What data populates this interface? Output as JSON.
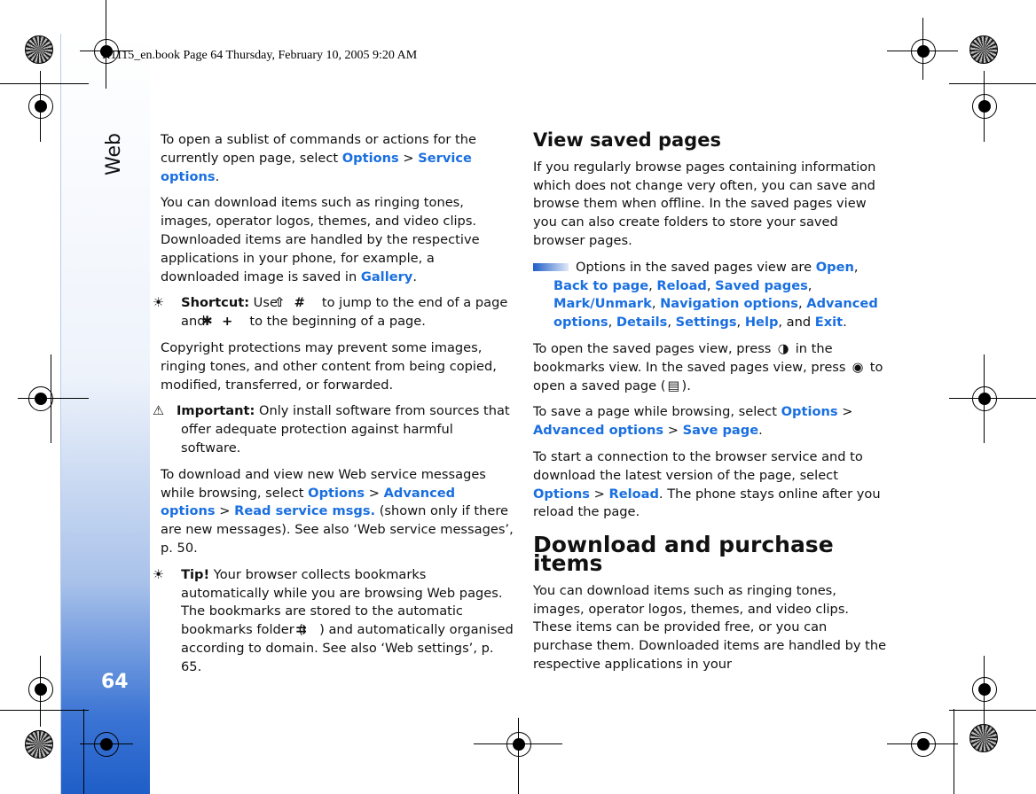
{
  "header": {
    "print_line": "R1115_en.book  Page 64  Thursday, February 10, 2005  9:20 AM"
  },
  "sidebar": {
    "section": "Web",
    "page_number": "64",
    "accent": "#1f5ec8"
  },
  "colors": {
    "link": "#1a6fe0"
  },
  "left_column": [
    {
      "type": "p",
      "runs": [
        {
          "t": "To open a sublist of commands or actions for the currently open page, select "
        },
        {
          "t": "Options",
          "s": "link"
        },
        {
          "t": " > "
        },
        {
          "t": "Service options",
          "s": "link"
        },
        {
          "t": "."
        }
      ]
    },
    {
      "type": "p",
      "runs": [
        {
          "t": "You can download items such as ringing tones, images, operator logos, themes, and video clips. Downloaded items are handled by the respective applications in your phone, for example, a downloaded image is saved in "
        },
        {
          "t": "Gallery",
          "s": "link"
        },
        {
          "t": "."
        }
      ]
    },
    {
      "type": "ind",
      "runs": [
        {
          "t": "☀",
          "s": "icon",
          "icon": "tip-bulb-icon"
        },
        {
          "t": " Shortcut:",
          "s": "bold"
        },
        {
          "t": " Use "
        },
        {
          "t": "⇧",
          "s": "icon",
          "icon": "shift-key-icon"
        },
        {
          "t": " "
        },
        {
          "t": "#",
          "s": "icon",
          "icon": "hash-key-icon"
        },
        {
          "t": " to jump to the end of a page and "
        },
        {
          "t": "✱",
          "s": "icon",
          "icon": "star-key-icon"
        },
        {
          "t": " "
        },
        {
          "t": "+",
          "s": "icon",
          "icon": "plus-key-icon"
        },
        {
          "t": " to the beginning of a page."
        }
      ]
    },
    {
      "type": "p",
      "runs": [
        {
          "t": "Copyright protections may prevent some images, ringing tones, and other content from being copied, modified, transferred, or forwarded."
        }
      ]
    },
    {
      "type": "ind",
      "runs": [
        {
          "t": "⚠",
          "s": "icon",
          "icon": "warning-icon"
        },
        {
          "t": "Important:",
          "s": "bold"
        },
        {
          "t": " Only install software from sources that offer adequate protection against harmful software."
        }
      ]
    },
    {
      "type": "p",
      "runs": [
        {
          "t": "To download and view new Web service messages while browsing, select "
        },
        {
          "t": "Options",
          "s": "link"
        },
        {
          "t": " > "
        },
        {
          "t": "Advanced options",
          "s": "link"
        },
        {
          "t": " > "
        },
        {
          "t": "Read service msgs.",
          "s": "link"
        },
        {
          "t": " (shown only if there are new messages). See also ‘Web service messages’, p. 50."
        }
      ]
    },
    {
      "type": "ind",
      "runs": [
        {
          "t": "☀",
          "s": "icon",
          "icon": "tip-bulb-icon"
        },
        {
          "t": " Tip!",
          "s": "bold"
        },
        {
          "t": " Your browser collects bookmarks automatically while you are browsing Web pages. The bookmarks are stored to the automatic bookmarks folder ("
        },
        {
          "t": "⇉",
          "s": "icon",
          "icon": "auto-bookmarks-folder-icon"
        },
        {
          "t": ") and automatically organised according to domain. See also ‘Web settings’, p. 65."
        }
      ]
    }
  ],
  "right_column": [
    {
      "type": "h2",
      "runs": [
        {
          "t": "View saved pages"
        }
      ]
    },
    {
      "type": "p",
      "runs": [
        {
          "t": "If you regularly browse pages containing information which does not change very often, you can save and browse them when offline. In the saved pages view you can also create folders to store your saved browser pages."
        }
      ]
    },
    {
      "type": "note",
      "runs": [
        {
          "t": "Options in the saved pages view are "
        },
        {
          "t": "Open",
          "s": "link"
        },
        {
          "t": ", "
        },
        {
          "t": "Back to page",
          "s": "link"
        },
        {
          "t": ", "
        },
        {
          "t": "Reload",
          "s": "link"
        },
        {
          "t": ", "
        },
        {
          "t": "Saved pages",
          "s": "link"
        },
        {
          "t": ", "
        },
        {
          "t": "Mark/Unmark",
          "s": "link"
        },
        {
          "t": ", "
        },
        {
          "t": "Navigation options",
          "s": "link"
        },
        {
          "t": ", "
        },
        {
          "t": "Advanced options",
          "s": "link"
        },
        {
          "t": ", "
        },
        {
          "t": "Details",
          "s": "link"
        },
        {
          "t": ", "
        },
        {
          "t": "Settings",
          "s": "link"
        },
        {
          "t": ", "
        },
        {
          "t": "Help",
          "s": "link"
        },
        {
          "t": ", and "
        },
        {
          "t": "Exit",
          "s": "link"
        },
        {
          "t": "."
        }
      ]
    },
    {
      "type": "p",
      "runs": [
        {
          "t": "To open the saved pages view, press "
        },
        {
          "t": "◑",
          "s": "icon",
          "icon": "joystick-right-icon"
        },
        {
          "t": " in the bookmarks view. In the saved pages view, press "
        },
        {
          "t": "◉",
          "s": "icon",
          "icon": "joystick-press-icon"
        },
        {
          "t": " to open a saved page ("
        },
        {
          "t": "▤",
          "s": "icon",
          "icon": "saved-page-icon"
        },
        {
          "t": ")."
        }
      ]
    },
    {
      "type": "p",
      "runs": [
        {
          "t": "To save a page while browsing, select "
        },
        {
          "t": "Options",
          "s": "link"
        },
        {
          "t": " > "
        },
        {
          "t": "Advanced options",
          "s": "link"
        },
        {
          "t": " > "
        },
        {
          "t": "Save page",
          "s": "link"
        },
        {
          "t": "."
        }
      ]
    },
    {
      "type": "p",
      "runs": [
        {
          "t": "To start a connection to the browser service and to download the latest version of the page, select "
        },
        {
          "t": "Options",
          "s": "link"
        },
        {
          "t": " > "
        },
        {
          "t": "Reload",
          "s": "link"
        },
        {
          "t": ". The phone stays online after you reload the page."
        }
      ]
    },
    {
      "type": "h1",
      "runs": [
        {
          "t": "Download and purchase items"
        }
      ]
    },
    {
      "type": "p",
      "runs": [
        {
          "t": "You can download items such as ringing tones, images, operator logos, themes, and video clips. These items can be provided free, or you can purchase them. Downloaded items are handled by the respective applications in your"
        }
      ]
    }
  ]
}
